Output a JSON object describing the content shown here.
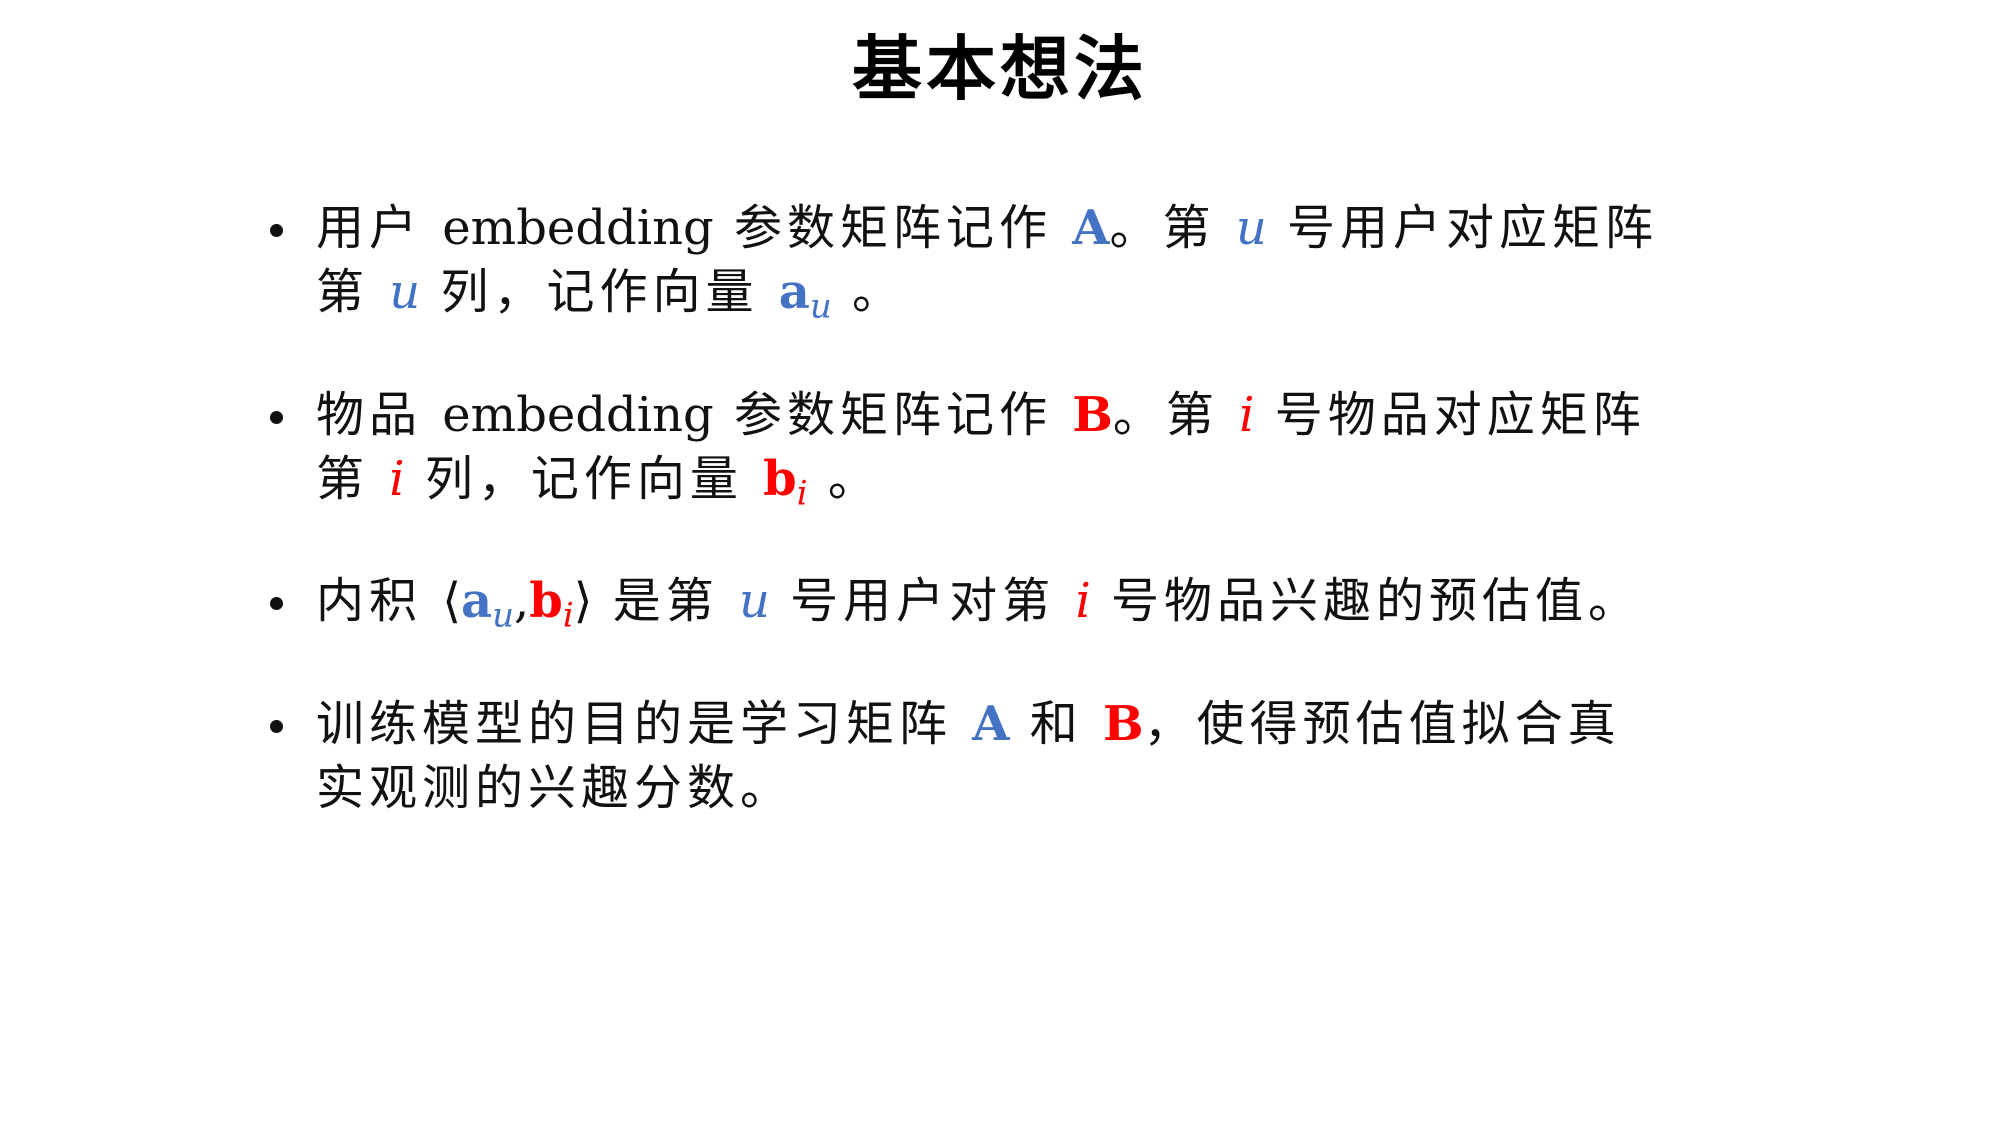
{
  "title": "基本想法",
  "colors": {
    "blue": "#4472C4",
    "red": "#FF0000",
    "text": "#111111"
  },
  "bullets": [
    {
      "p1": "用户 ",
      "p1_latin": "embedding",
      "p2": " 参数矩阵记作 ",
      "A": "A",
      "p3": "。第 ",
      "u": "u",
      "p4": " 号用户对应矩阵",
      "p5": "第 ",
      "u2": "u",
      "p6": " 列，记作向量 ",
      "vec": "a",
      "vec_sub": "u",
      "p7": " 。"
    },
    {
      "p1": "物品 ",
      "p1_latin": "embedding",
      "p2": " 参数矩阵记作 ",
      "B": "B",
      "p3": "。第 ",
      "i": "i",
      "p4": " 号物品对应矩阵",
      "p5": "第 ",
      "i2": "i",
      "p6": " 列，记作向量 ",
      "vec": "b",
      "vec_sub": "i",
      "p7": " 。"
    },
    {
      "p1": "内积 ",
      "lang": "⟨",
      "a": "a",
      "a_sub": "u",
      "comma": ",",
      "b": "b",
      "b_sub": "i",
      "rang": "⟩",
      "p2": " 是第 ",
      "u": "u",
      "p3": " 号用户对第 ",
      "i": "i",
      "p4": " 号物品兴趣的预估值。"
    },
    {
      "p1": "训练模型的目的是学习矩阵 ",
      "A": "A",
      "p2": " 和 ",
      "B": "B",
      "p3": "，使得预估值拟合真",
      "p4": "实观测的兴趣分数。"
    }
  ]
}
